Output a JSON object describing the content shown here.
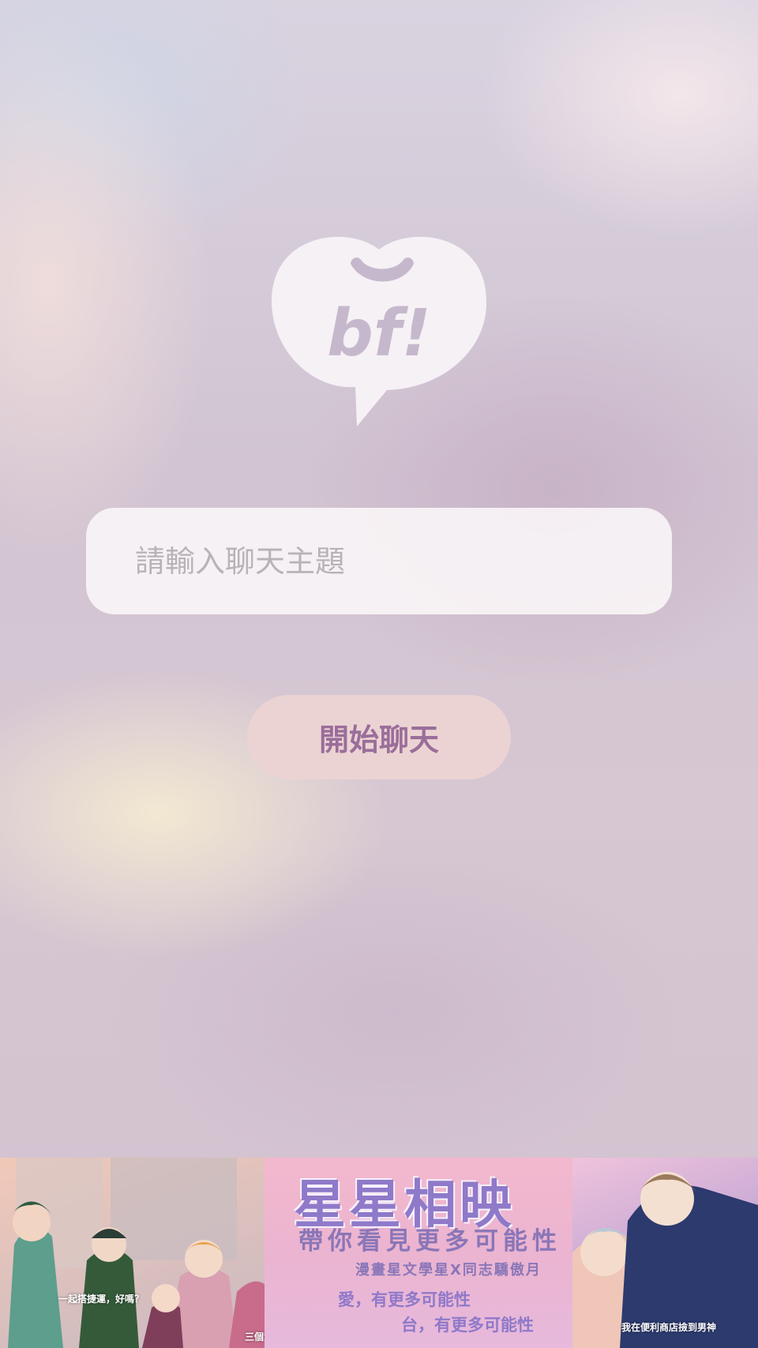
{
  "logo": {
    "text": "bf!"
  },
  "topic_input": {
    "placeholder": "請輸入聊天主題",
    "value": ""
  },
  "start_button": {
    "label": "開始聊天"
  },
  "banner": {
    "title": "星星相映",
    "subtitle": "帶你看見更多可能性",
    "collab": "漫畫星文學星X同志驕傲月",
    "line1": "愛，有更多可能性",
    "line2": "台，有更多可能性",
    "caption_left": "一起搭捷運，好嗎？",
    "caption_middle": "三個女人不結婚",
    "caption_right": "我在便利商店撿到男神"
  },
  "colors": {
    "logo_fill": "#f5f1f5",
    "logo_mark": "#c6b8cc",
    "input_bg": "#faf7f8",
    "button_bg": "#ecd3d3",
    "button_text": "#9a6e9a"
  }
}
